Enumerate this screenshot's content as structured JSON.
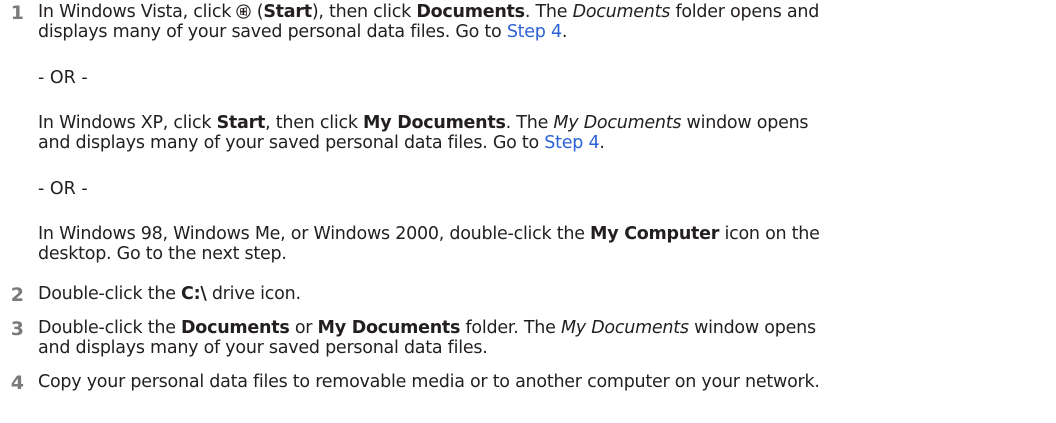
{
  "steps": [
    {
      "number": "1",
      "p1": {
        "a": "In Windows Vista, click ",
        "b": " (",
        "start": "Start",
        "c": "), then click ",
        "documents": "Documents",
        "d": ". The ",
        "documents_folder": "Documents",
        "e": " folder opens and",
        "f": "displays many of your saved personal data files. Go to ",
        "link": "Step 4",
        "g": "."
      },
      "or1": "- OR -",
      "p2": {
        "a": "In Windows XP, click ",
        "start": "Start",
        "b": ", then click ",
        "my_documents": "My Documents",
        "c": ". The ",
        "my_documents_window": "My Documents",
        "d": " window opens",
        "e": "and displays many of your saved personal data files. Go to ",
        "link": "Step 4",
        "f": "."
      },
      "or2": "- OR -",
      "p3": {
        "a": "In Windows 98, Windows Me, or Windows 2000, double-click the ",
        "my_computer": "My Computer",
        "b": " icon on the",
        "c": "desktop. Go to the next step."
      }
    },
    {
      "number": "2",
      "a": "Double-click the ",
      "drive": "C:\\",
      "b": " drive icon."
    },
    {
      "number": "3",
      "a": "Double-click the ",
      "documents": "Documents",
      "b": " or ",
      "my_documents": "My Documents",
      "c": " folder. The ",
      "my_documents_window": "My Documents",
      "d": " window opens",
      "e": "and displays many of your saved personal data files."
    },
    {
      "number": "4",
      "a": "Copy your personal data files to removable media or to another computer on your network."
    }
  ],
  "icons": {
    "start": "windows-start-orb-icon"
  },
  "colors": {
    "link": "#2b62d6",
    "step_number": "#7a7a7a",
    "text": "#231f20"
  }
}
